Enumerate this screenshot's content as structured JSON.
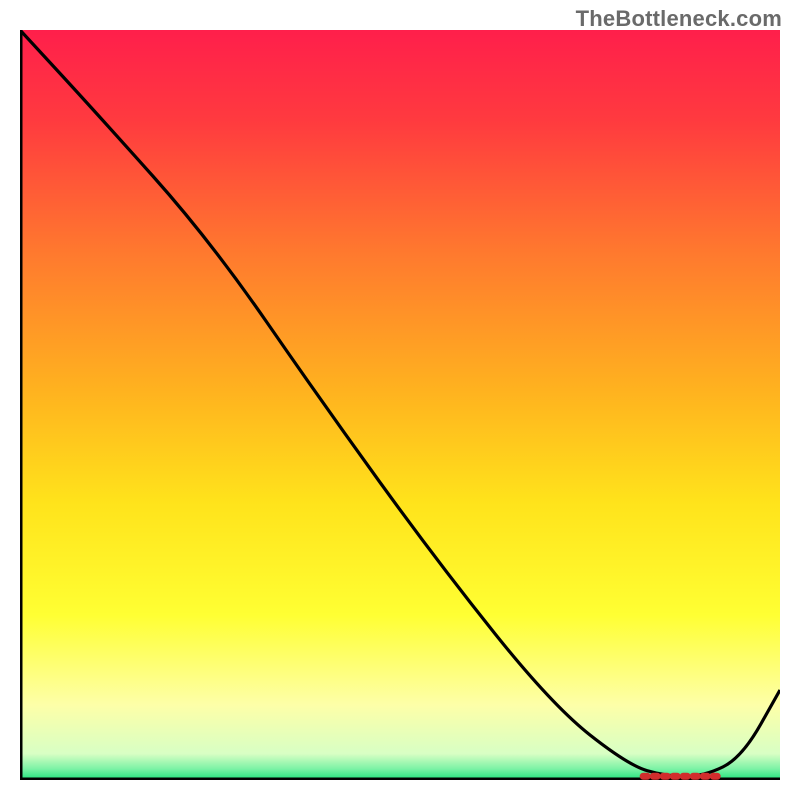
{
  "watermark": "TheBottleneck.com",
  "chart_data": {
    "type": "line",
    "title": "",
    "xlabel": "",
    "ylabel": "",
    "xlim": [
      0,
      100
    ],
    "ylim": [
      0,
      100
    ],
    "grid": false,
    "series": [
      {
        "name": "curve",
        "x": [
          0,
          10,
          25,
          40,
          55,
          70,
          80,
          85,
          90,
          95,
          100
        ],
        "y": [
          100,
          89,
          72,
          50,
          29,
          10,
          2,
          0.5,
          0.5,
          3,
          12
        ]
      }
    ],
    "marker": {
      "x_start": 82,
      "x_end": 92,
      "y": 0.5
    },
    "gradient_stops": [
      {
        "offset": 0.0,
        "color": "#ff1f4b"
      },
      {
        "offset": 0.12,
        "color": "#ff3a3f"
      },
      {
        "offset": 0.3,
        "color": "#ff7a2e"
      },
      {
        "offset": 0.48,
        "color": "#ffb21f"
      },
      {
        "offset": 0.63,
        "color": "#ffe31b"
      },
      {
        "offset": 0.78,
        "color": "#ffff33"
      },
      {
        "offset": 0.9,
        "color": "#fdffa8"
      },
      {
        "offset": 0.965,
        "color": "#d8ffc4"
      },
      {
        "offset": 0.985,
        "color": "#7cf2a6"
      },
      {
        "offset": 1.0,
        "color": "#1ee27a"
      }
    ]
  }
}
